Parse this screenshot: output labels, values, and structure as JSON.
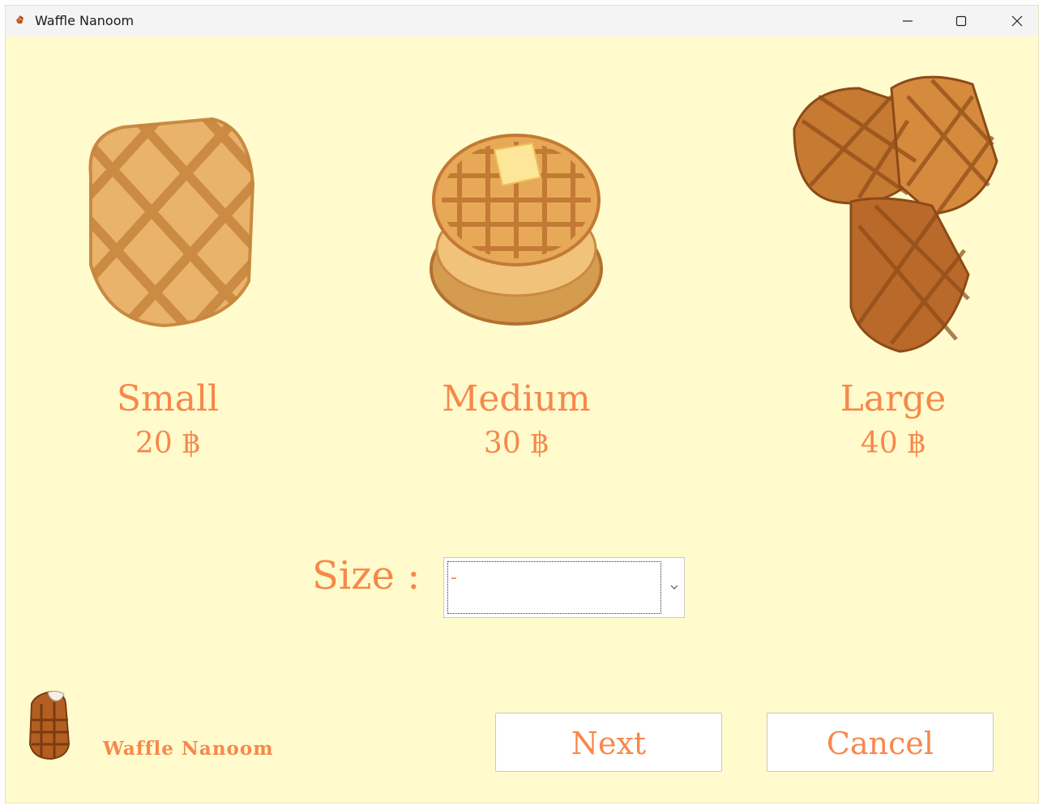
{
  "window": {
    "title": "Waffle Nanoom",
    "controls": {
      "minimize": "minimize-icon",
      "maximize": "maximize-icon",
      "close": "close-icon"
    }
  },
  "products": [
    {
      "name": "Small",
      "price": "20 ฿",
      "icon": "single-waffle-icon"
    },
    {
      "name": "Medium",
      "price": "30 ฿",
      "icon": "waffle-stack-icon"
    },
    {
      "name": "Large",
      "price": "40 ฿",
      "icon": "waffle-pile-icon"
    }
  ],
  "size": {
    "label": "Size :",
    "selected": "-"
  },
  "brand": {
    "name": "Waffle Nanoom",
    "icon": "bitten-waffle-icon"
  },
  "buttons": {
    "next": "Next",
    "cancel": "Cancel"
  },
  "colors": {
    "accent": "#f7884b",
    "background": "#fffbcd"
  }
}
